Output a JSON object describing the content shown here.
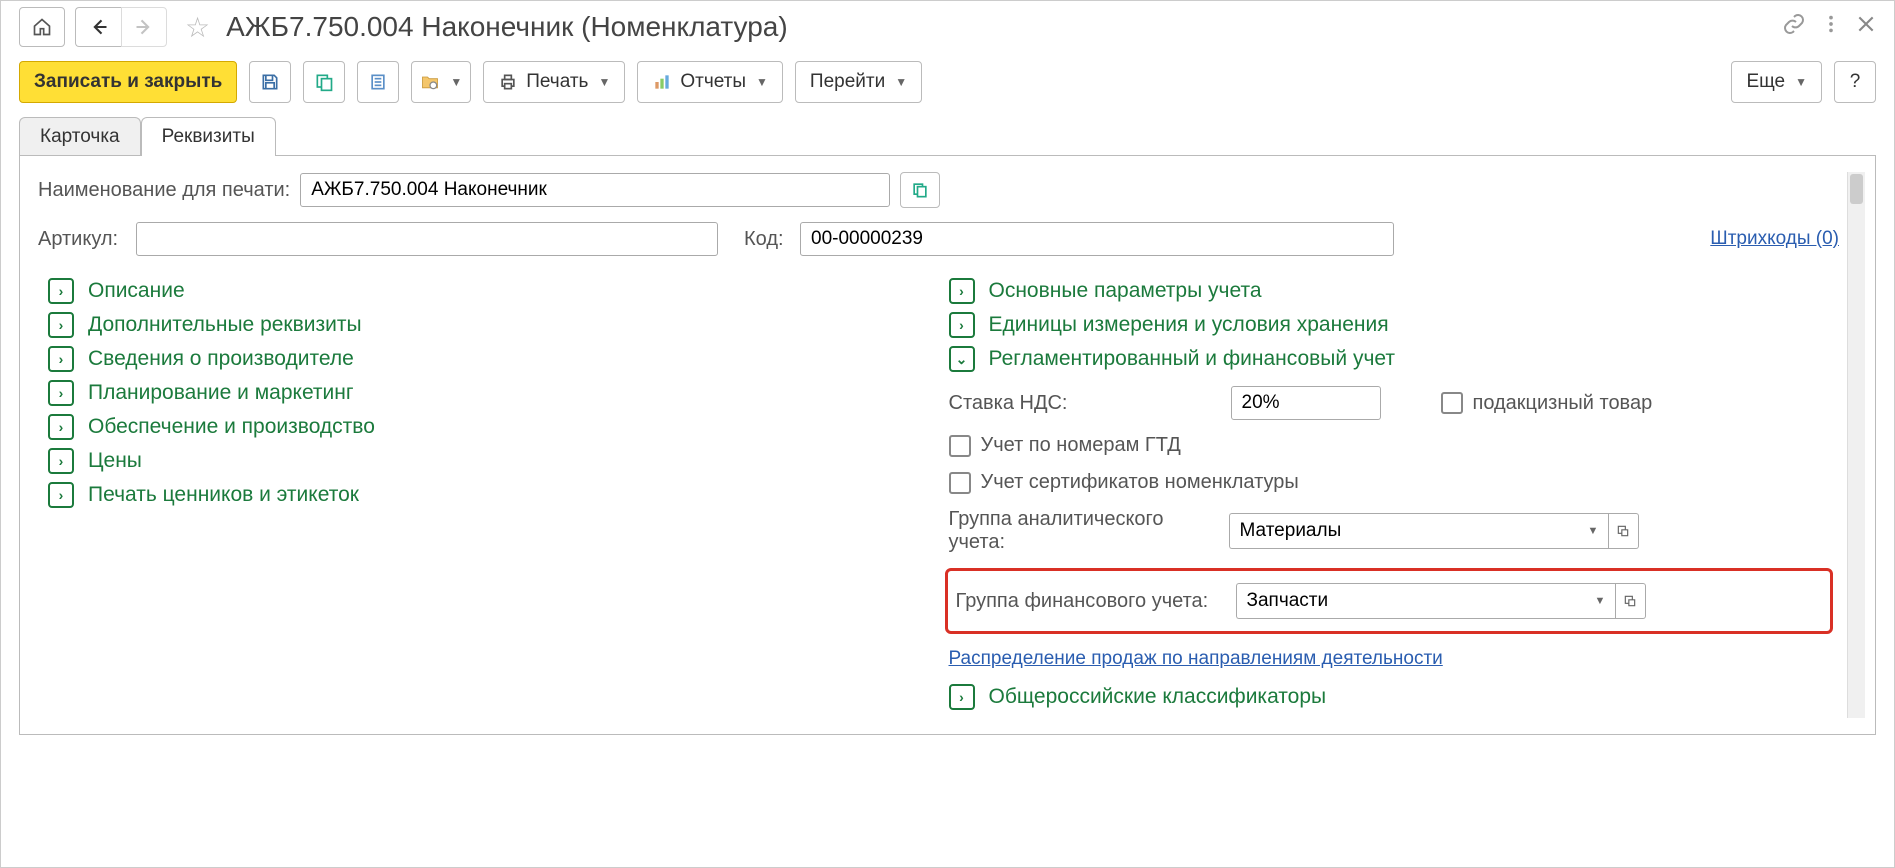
{
  "header": {
    "title": "АЖБ7.750.004 Наконечник (Номенклатура)"
  },
  "toolbar": {
    "save_close": "Записать и закрыть",
    "print": "Печать",
    "reports": "Отчеты",
    "goto": "Перейти",
    "more": "Еще",
    "help": "?"
  },
  "tabs": {
    "card": "Карточка",
    "props": "Реквизиты"
  },
  "fields": {
    "print_name_label": "Наименование для печати:",
    "print_name_value": "АЖБ7.750.004 Наконечник",
    "article_label": "Артикул:",
    "article_value": "",
    "code_label": "Код:",
    "code_value": "00-00000239",
    "barcodes": "Штрихкоды (0)"
  },
  "sections_left": [
    "Описание",
    "Дополнительные реквизиты",
    "Сведения о производителе",
    "Планирование и маркетинг",
    "Обеспечение и производство",
    "Цены",
    "Печать ценников и этикеток"
  ],
  "sections_right": {
    "main_params": "Основные параметры учета",
    "units": "Единицы измерения и условия хранения",
    "reg_fin": "Регламентированный и финансовый учет",
    "vat_label": "Ставка НДС:",
    "vat_value": "20%",
    "excise_label": "подакцизный товар",
    "gtd_label": "Учет по номерам ГТД",
    "cert_label": "Учет сертификатов номенклатуры",
    "anal_group_label": "Группа аналитического учета:",
    "anal_group_value": "Материалы",
    "fin_group_label": "Группа финансового учета:",
    "fin_group_value": "Запчасти",
    "sales_dist": "Распределение продаж по направлениям деятельности",
    "classifiers": "Общероссийские классификаторы"
  }
}
